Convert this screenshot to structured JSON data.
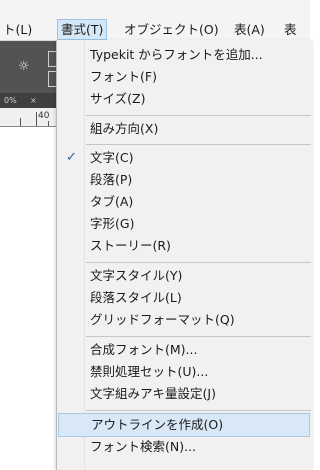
{
  "menubar": {
    "items": [
      {
        "label": "ト(L)"
      },
      {
        "label": "書式(T)"
      },
      {
        "label": "オブジェクト(O)"
      },
      {
        "label": "表(A)"
      },
      {
        "label": "表"
      }
    ]
  },
  "toolbar": {
    "icon": "sun-icon",
    "tab_zoom": "0%",
    "tab_close": "×",
    "ruler_label": "40"
  },
  "dropdown": {
    "items": [
      {
        "label": "Typekit からフォントを追加..."
      },
      {
        "label": "フォント(F)"
      },
      {
        "label": "サイズ(Z)"
      },
      {
        "label": "組み方向(X)"
      },
      {
        "label": "文字(C)",
        "checked": "✓"
      },
      {
        "label": "段落(P)"
      },
      {
        "label": "タブ(A)"
      },
      {
        "label": "字形(G)"
      },
      {
        "label": "ストーリー(R)"
      },
      {
        "label": "文字スタイル(Y)"
      },
      {
        "label": "段落スタイル(L)"
      },
      {
        "label": "グリッドフォーマット(Q)"
      },
      {
        "label": "合成フォント(M)..."
      },
      {
        "label": "禁則処理セット(U)..."
      },
      {
        "label": "文字組みアキ量設定(J)"
      },
      {
        "label": "アウトラインを作成(O)"
      },
      {
        "label": "フォント検索(N)..."
      }
    ]
  },
  "colors": {
    "hover_bg": "#d9e8f7",
    "check_mark": "#2a5ea8",
    "app_dark": "#535353"
  }
}
